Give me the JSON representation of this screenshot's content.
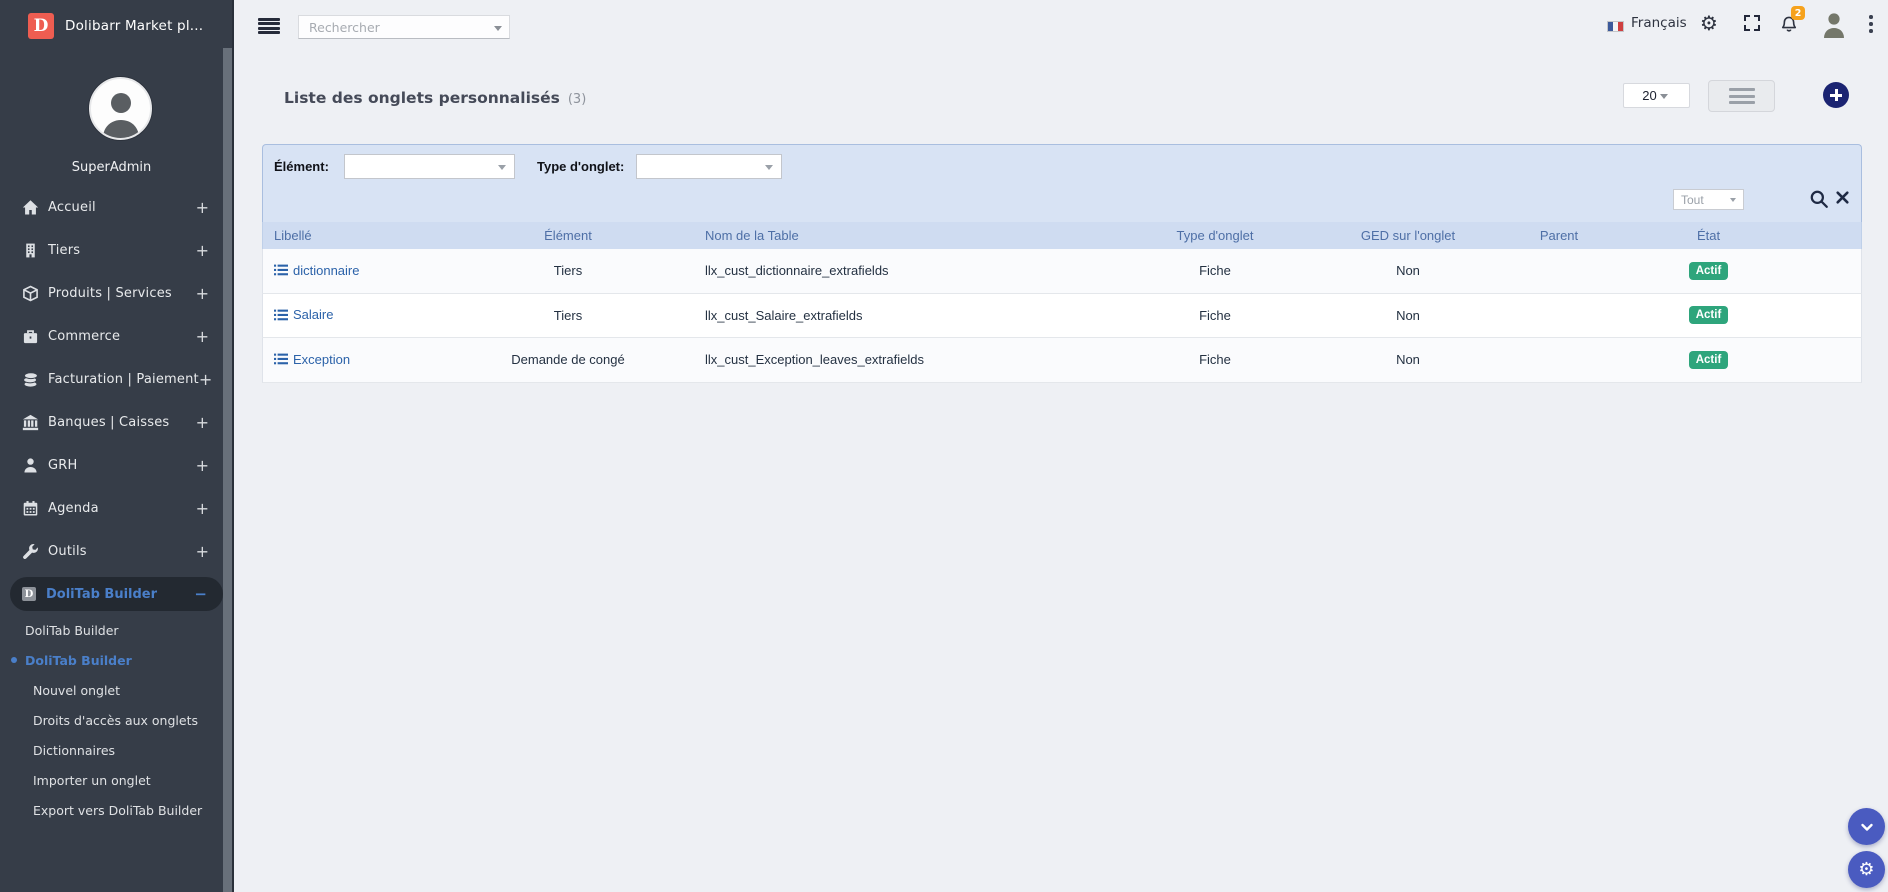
{
  "brand": {
    "name": "Dolibarr Market pl...",
    "logo_letter": "D"
  },
  "user": {
    "name": "SuperAdmin"
  },
  "topbar": {
    "search": {
      "placeholder": "Rechercher"
    },
    "language": {
      "label": "Français"
    },
    "notifications": {
      "count": "2"
    }
  },
  "sidebar": {
    "items": [
      {
        "label": "Accueil",
        "icon": "home-icon",
        "expander": "+"
      },
      {
        "label": "Tiers",
        "icon": "building-icon",
        "expander": "+"
      },
      {
        "label": "Produits | Services",
        "icon": "cube-icon",
        "expander": "+"
      },
      {
        "label": "Commerce",
        "icon": "briefcase-icon",
        "expander": "+"
      },
      {
        "label": "Facturation | Paiement",
        "icon": "coins-icon",
        "expander": "+"
      },
      {
        "label": "Banques | Caisses",
        "icon": "bank-icon",
        "expander": "+"
      },
      {
        "label": "GRH",
        "icon": "person-icon",
        "expander": "+"
      },
      {
        "label": "Agenda",
        "icon": "calendar-icon",
        "expander": "+"
      },
      {
        "label": "Outils",
        "icon": "wrench-icon",
        "expander": "+"
      }
    ],
    "active_item": {
      "label": "DoliTab Builder",
      "logo_letter": "D",
      "expander": "−"
    },
    "submenu": [
      {
        "label": "DoliTab Builder",
        "level": 1,
        "active": false,
        "bullet": false
      },
      {
        "label": "DoliTab Builder",
        "level": 1,
        "active": true,
        "bullet": true
      },
      {
        "label": "Nouvel onglet",
        "level": 2,
        "active": false,
        "bullet": false
      },
      {
        "label": "Droits d'accès aux onglets",
        "level": 2,
        "active": false,
        "bullet": false
      },
      {
        "label": "Dictionnaires",
        "level": 2,
        "active": false,
        "bullet": false
      },
      {
        "label": "Importer un onglet",
        "level": 2,
        "active": false,
        "bullet": false
      },
      {
        "label": "Export vers DoliTab Builder",
        "level": 2,
        "active": false,
        "bullet": false
      }
    ]
  },
  "page": {
    "title": "Liste des onglets personnalisés",
    "count": "(3)",
    "page_size": "20"
  },
  "filters": {
    "element_label": "Élément:",
    "type_label": "Type d'onglet:",
    "quick_filter_placeholder": "Tout"
  },
  "table": {
    "columns": [
      {
        "label": "Libellé",
        "align": "left"
      },
      {
        "label": "Élément",
        "align": "center"
      },
      {
        "label": "Nom de la Table",
        "align": "left"
      },
      {
        "label": "Type d'onglet",
        "align": "center"
      },
      {
        "label": "GED sur l'onglet",
        "align": "center"
      },
      {
        "label": "Parent",
        "align": "center"
      },
      {
        "label": "État",
        "align": "center"
      },
      {
        "label": "",
        "align": "center"
      }
    ],
    "rows": [
      {
        "libelle": "dictionnaire",
        "element": "Tiers",
        "table_name": "llx_cust_dictionnaire_extrafields",
        "type": "Fiche",
        "ged": "Non",
        "parent": "",
        "etat": "Actif"
      },
      {
        "libelle": "Salaire",
        "element": "Tiers",
        "table_name": "llx_cust_Salaire_extrafields",
        "type": "Fiche",
        "ged": "Non",
        "parent": "",
        "etat": "Actif"
      },
      {
        "libelle": "Exception",
        "element": "Demande de congé",
        "table_name": "llx_cust_Exception_leaves_extrafields",
        "type": "Fiche",
        "ged": "Non",
        "parent": "",
        "etat": "Actif"
      }
    ]
  },
  "colors": {
    "sidebar_bg": "#363d48",
    "accent_blue": "#4a7fc9",
    "link_blue": "#2b62a9",
    "badge_green": "#2ea57c",
    "notif_orange": "#f6a21c",
    "fab_indigo": "#4a5bc0",
    "add_navy": "#1b2472",
    "logo_red": "#ee5d51"
  }
}
